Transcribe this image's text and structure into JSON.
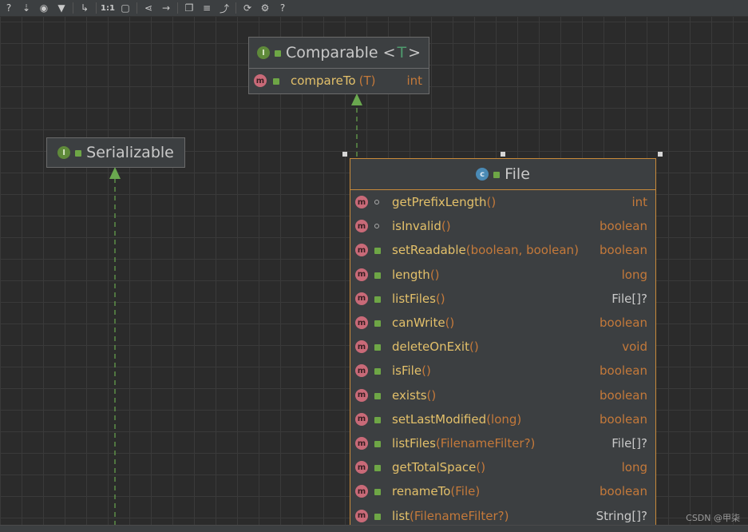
{
  "toolbar": {
    "buttons": [
      "help-icon",
      "sort-icon",
      "eye-icon",
      "filter-icon",
      "route-icon",
      "actual-size",
      "fit-icon",
      "share-icon",
      "layout-icon",
      "copy-icon",
      "align-icon",
      "export-icon",
      "refresh-icon",
      "settings-icon",
      "question-icon"
    ],
    "actual_size_label": "1:1",
    "question_label": "?"
  },
  "comparable": {
    "badge": "I",
    "title": "Comparable",
    "generic_open": "<",
    "generic_param": "T",
    "generic_close": ">",
    "method": {
      "badge": "m",
      "name": "compareTo",
      "params": "(T)",
      "type": "int"
    }
  },
  "serializable": {
    "badge": "I",
    "title": "Serializable"
  },
  "file": {
    "badge": "c",
    "title": "File",
    "methods": [
      {
        "name": "getPrefixLength",
        "params": "()",
        "type": "int",
        "lock": false
      },
      {
        "name": "isInvalid",
        "params": " ()",
        "type": "boolean",
        "lock": false
      },
      {
        "name": "setReadable",
        "params": " (boolean, boolean)",
        "type": "boolean",
        "lock": true
      },
      {
        "name": "length",
        "params": "()",
        "type": "long",
        "lock": true
      },
      {
        "name": "listFiles",
        "params": "()",
        "type": "File[]?",
        "lock": true
      },
      {
        "name": "canWrite",
        "params": " ()",
        "type": "boolean",
        "lock": true
      },
      {
        "name": "deleteOnExit",
        "params": " ()",
        "type": "void",
        "lock": true
      },
      {
        "name": "isFile",
        "params": "()",
        "type": "boolean",
        "lock": true
      },
      {
        "name": "exists",
        "params": "()",
        "type": "boolean",
        "lock": true
      },
      {
        "name": "setLastModified",
        "params": " (long)",
        "type": "boolean",
        "lock": true
      },
      {
        "name": "listFiles",
        "params": "(FilenameFilter?)",
        "type": "File[]?",
        "lock": true
      },
      {
        "name": "getTotalSpace",
        "params": " ()",
        "type": "long",
        "lock": true
      },
      {
        "name": "renameTo",
        "params": " (File)",
        "type": "boolean",
        "lock": true
      },
      {
        "name": "list",
        "params": "(FilenameFilter?)",
        "type": "String[]?",
        "lock": true
      }
    ]
  },
  "watermark": "CSDN @甲柒",
  "colors": {
    "canvas": "#2b2b2b",
    "interface": "#5f8a3a",
    "class": "#4a8ab5",
    "method": "#c96a78",
    "edge": "#6aa84f"
  }
}
